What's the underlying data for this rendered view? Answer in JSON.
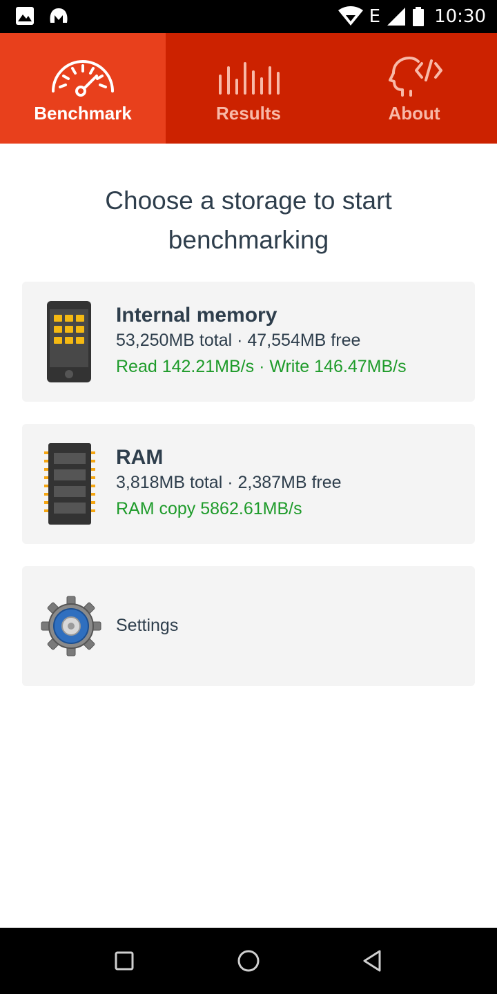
{
  "status_bar": {
    "time": "10:30",
    "network": "E",
    "icons": [
      "image-icon",
      "malwarebytes-icon",
      "wifi-icon",
      "signal-icon",
      "battery-icon"
    ]
  },
  "tabs": [
    {
      "label": "Benchmark",
      "icon": "speedometer-icon",
      "active": true
    },
    {
      "label": "Results",
      "icon": "bars-icon",
      "active": false
    },
    {
      "label": "About",
      "icon": "head-code-icon",
      "active": false
    }
  ],
  "colors": {
    "tab_bar": "#cc2200",
    "tab_active": "#e8401c",
    "speed_text": "#1e9b2a",
    "text": "#2e3e4c",
    "card_bg": "#f4f4f4"
  },
  "heading": "Choose a storage to start benchmarking",
  "storages": [
    {
      "icon": "phone-icon",
      "title": "Internal memory",
      "capacity": "53,250MB total · 47,554MB free",
      "speed": "Read 142.21MB/s · Write 146.47MB/s"
    },
    {
      "icon": "ram-chip-icon",
      "title": "RAM",
      "capacity": "3,818MB total · 2,387MB free",
      "speed": "RAM copy 5862.61MB/s"
    }
  ],
  "settings": {
    "icon": "gear-icon",
    "label": "Settings"
  },
  "nav_bar": {
    "buttons": [
      "recents-button",
      "home-button",
      "back-button"
    ]
  }
}
